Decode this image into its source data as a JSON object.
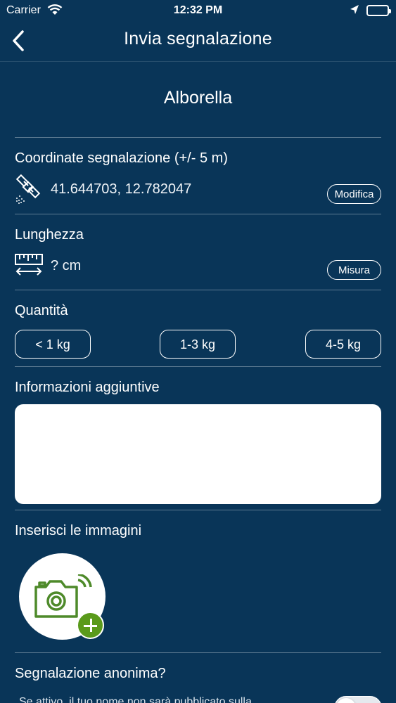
{
  "status_bar": {
    "carrier": "Carrier",
    "time": "12:32 PM"
  },
  "nav": {
    "title": "Invia segnalazione",
    "back_icon": "chevron-left-icon"
  },
  "species": "Alborella",
  "coordinates": {
    "label": "Coordinate segnalazione (+/- 5 m)",
    "icon": "satellite-icon",
    "value": "41.644703, 12.782047",
    "button": "Modifica"
  },
  "length": {
    "label": "Lunghezza",
    "icon": "ruler-icon",
    "value": "? cm",
    "button": "Misura"
  },
  "quantity": {
    "label": "Quantità",
    "options": [
      "< 1 kg",
      "1-3 kg",
      "4-5 kg"
    ]
  },
  "info": {
    "label": "Informazioni aggiuntive",
    "value": ""
  },
  "images": {
    "label": "Inserisci le immagini",
    "icon": "camera-add-icon"
  },
  "anonymous": {
    "label": "Segnalazione anonima?",
    "description": "Se attivo, il tuo nome non sarà pubblicato sulla",
    "toggle_on": false
  },
  "colors": {
    "background": "#093558",
    "accent_green": "#5a9a1b",
    "camera_green": "#4e8a2a"
  }
}
